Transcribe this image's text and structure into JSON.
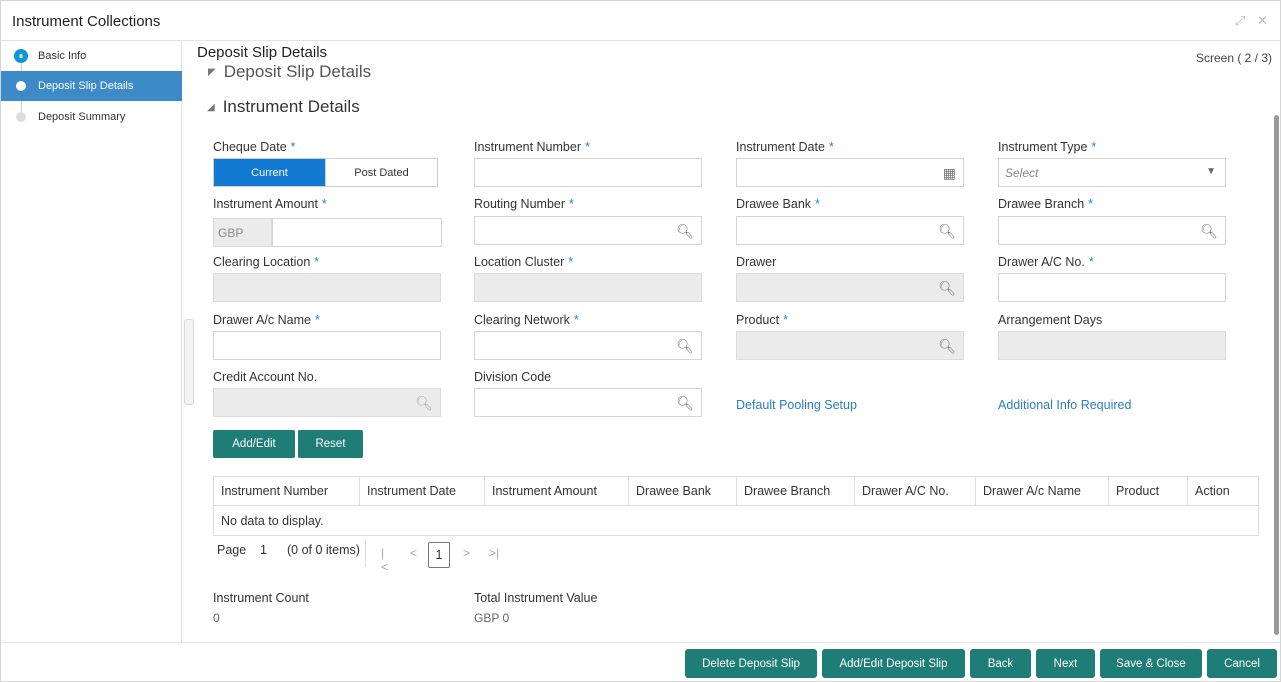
{
  "window": {
    "title": "Instrument Collections"
  },
  "sidebar": {
    "steps": [
      {
        "label": "Basic Info",
        "state": "done"
      },
      {
        "label": "Deposit Slip Details",
        "state": "active"
      },
      {
        "label": "Deposit Summary",
        "state": "pending"
      }
    ]
  },
  "page": {
    "title": "Deposit Slip Details",
    "screen": "Screen ( 2 / 3)",
    "collapsed_section": "Deposit Slip Details",
    "section": "Instrument Details"
  },
  "form": {
    "cheque_date": {
      "label": "Cheque Date",
      "options": [
        "Current",
        "Post Dated"
      ],
      "selected": "Current"
    },
    "instrument_number": {
      "label": "Instrument Number"
    },
    "instrument_date": {
      "label": "Instrument Date"
    },
    "instrument_type": {
      "label": "Instrument Type",
      "placeholder": "Select"
    },
    "instrument_amount": {
      "label": "Instrument Amount",
      "currency": "GBP"
    },
    "routing_number": {
      "label": "Routing Number"
    },
    "drawee_bank": {
      "label": "Drawee Bank"
    },
    "drawee_branch": {
      "label": "Drawee Branch"
    },
    "clearing_location": {
      "label": "Clearing Location"
    },
    "location_cluster": {
      "label": "Location Cluster"
    },
    "drawer": {
      "label": "Drawer"
    },
    "drawer_ac_no": {
      "label": "Drawer A/C No."
    },
    "drawer_ac_name": {
      "label": "Drawer A/c Name"
    },
    "clearing_network": {
      "label": "Clearing Network"
    },
    "product": {
      "label": "Product"
    },
    "arrangement_days": {
      "label": "Arrangement Days"
    },
    "credit_account_no": {
      "label": "Credit Account No."
    },
    "division_code": {
      "label": "Division Code"
    },
    "req_mark": "*"
  },
  "links": {
    "default_pooling": "Default Pooling Setup",
    "additional_info": "Additional Info Required"
  },
  "actions": {
    "add_edit": "Add/Edit",
    "reset": "Reset"
  },
  "grid": {
    "columns": [
      "Instrument Number",
      "Instrument Date",
      "Instrument Amount",
      "Drawee Bank",
      "Drawee Branch",
      "Drawer A/C No.",
      "Drawer A/c Name",
      "Product",
      "Action"
    ],
    "empty_text": "No data to display."
  },
  "pager": {
    "page_label": "Page",
    "page": "1",
    "items": "(0 of 0 items)",
    "current": "1"
  },
  "summary": {
    "count_label": "Instrument Count",
    "count_value": "0",
    "total_label": "Total Instrument Value",
    "total_value": "GBP 0"
  },
  "footer": {
    "delete": "Delete Deposit Slip",
    "add_edit_slip": "Add/Edit Deposit Slip",
    "back": "Back",
    "next": "Next",
    "save_close": "Save & Close",
    "cancel": "Cancel"
  },
  "colors": {
    "accent": "#1f7d78",
    "active_step": "#3d8ac9",
    "toggle_on": "#127bd1",
    "required": "#1a8bd1",
    "link": "#2a7fc0"
  }
}
